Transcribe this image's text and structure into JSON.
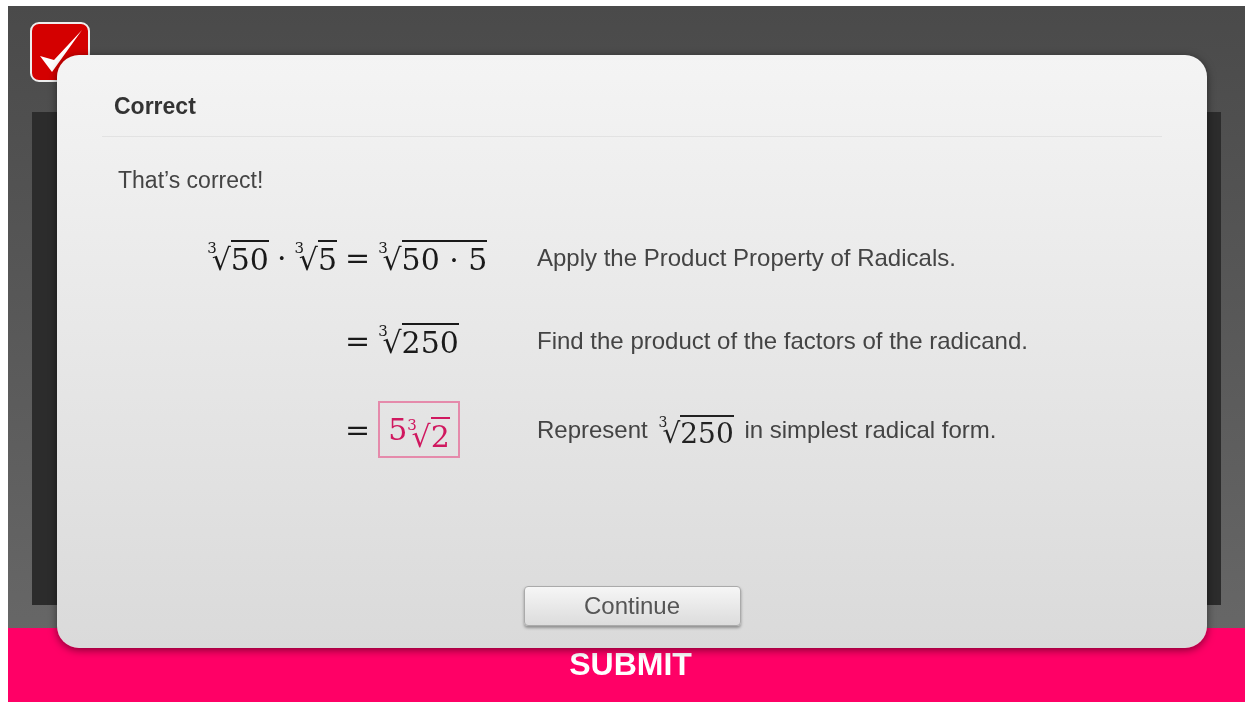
{
  "footer": {
    "submit_label": "SUBMIT"
  },
  "dialog": {
    "title": "Correct",
    "message": "That’s correct!",
    "steps": [
      {
        "lhs": [
          {
            "kind": "radical",
            "index": "3",
            "sign": "√",
            "radicand": "50"
          },
          {
            "kind": "operator",
            "text": "·"
          },
          {
            "kind": "radical",
            "index": "3",
            "sign": "√",
            "radicand": "5"
          }
        ],
        "rhs": [
          {
            "kind": "operator",
            "text": "="
          },
          {
            "kind": "radical",
            "index": "3",
            "sign": "√",
            "radicand": "50 · 5"
          }
        ],
        "explanation": [
          {
            "kind": "text",
            "text": "Apply the Product Property of Radicals."
          }
        ]
      },
      {
        "rhs": [
          {
            "kind": "operator",
            "text": "="
          },
          {
            "kind": "radical",
            "index": "3",
            "sign": "√",
            "radicand": "250"
          }
        ],
        "explanation": [
          {
            "kind": "text",
            "text": "Find the product of the factors of the radicand."
          }
        ]
      },
      {
        "rhs": [
          {
            "kind": "operator",
            "text": "="
          },
          {
            "kind": "answer",
            "coefficient": "5",
            "index": "3",
            "sign": "√",
            "radicand": "2"
          }
        ],
        "explanation": [
          {
            "kind": "text",
            "text": "Represent "
          },
          {
            "kind": "radical",
            "index": "3",
            "sign": "√",
            "radicand": "250"
          },
          {
            "kind": "text",
            "text": " in simplest radical form."
          }
        ]
      }
    ],
    "continue_label": "Continue"
  }
}
